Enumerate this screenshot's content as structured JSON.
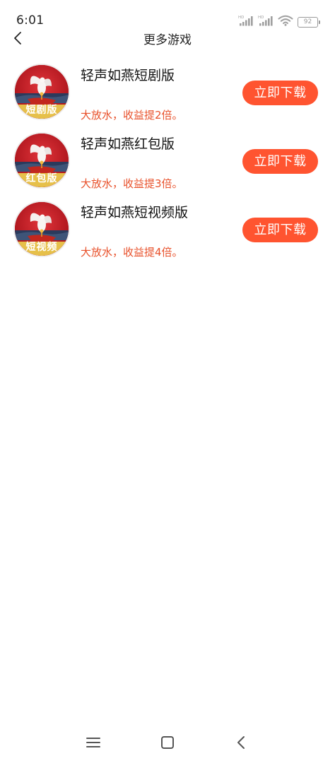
{
  "status_bar": {
    "time": "6:01",
    "battery_level": "92",
    "icons": [
      "hd-signal-icon",
      "hd-signal-icon",
      "wifi-icon",
      "battery-icon"
    ]
  },
  "header": {
    "title": "更多游戏",
    "back_icon": "chevron-left-icon"
  },
  "games": [
    {
      "title": "轻声如燕短剧版",
      "description": "大放水，收益提2倍。",
      "avatar_label": "短剧版",
      "button_label": "立即下载"
    },
    {
      "title": "轻声如燕红包版",
      "description": "大放水，收益提3倍。",
      "avatar_label": "红包版",
      "button_label": "立即下载"
    },
    {
      "title": "轻声如燕短视频版",
      "description": "大放水，收益提4倍。",
      "avatar_label": "短视频",
      "button_label": "立即下载"
    }
  ],
  "nav_bar": {
    "icons": [
      "menu-icon",
      "home-icon",
      "back-icon"
    ]
  },
  "colors": {
    "accent": "#ff5430",
    "desc_text": "#e8502a",
    "avatar_bg": "#c0171c"
  }
}
